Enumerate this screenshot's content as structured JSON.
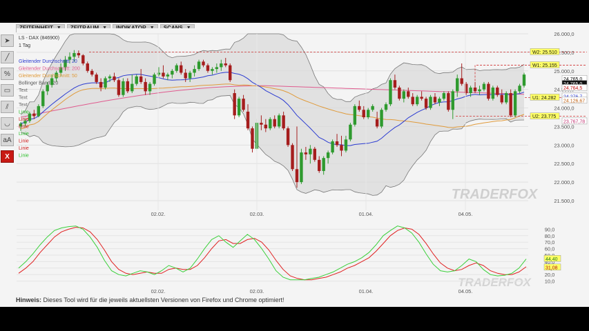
{
  "menu": [
    {
      "label": "ZEITEINHEIT"
    },
    {
      "label": "ZEITRAUM"
    },
    {
      "label": "INDIKATOR"
    },
    {
      "label": "SCANS"
    }
  ],
  "tools": [
    {
      "name": "cursor-tool-icon",
      "glyph": "➤",
      "red": false
    },
    {
      "name": "line-tool-icon",
      "glyph": "╱",
      "red": false
    },
    {
      "name": "percent-tool-icon",
      "glyph": "%",
      "red": false
    },
    {
      "name": "ruler-tool-icon",
      "glyph": "▭",
      "red": false
    },
    {
      "name": "parallel-lines-tool-icon",
      "glyph": "⫽",
      "red": false
    },
    {
      "name": "curve-tool-icon",
      "glyph": "◡",
      "red": false
    },
    {
      "name": "text-tool-icon",
      "glyph": "aA",
      "red": false
    },
    {
      "name": "delete-tool-icon",
      "glyph": "X",
      "red": true
    }
  ],
  "legend": {
    "symbol": "LS - DAX (846900)",
    "timeframe": "1 Tag",
    "entries": [
      {
        "text": "Gleitender Durchschnitt: 20",
        "color": "#2b3bd1"
      },
      {
        "text": "Gleitender Durchschnitt: 200",
        "color": "#e05a8e"
      },
      {
        "text": "Gleitender Durchschnitt: 50",
        "color": "#e09a3a"
      },
      {
        "text": "Bollinger Band: 20",
        "color": "#555555"
      },
      {
        "text": "Text",
        "color": "#666666"
      },
      {
        "text": "Text",
        "color": "#666666"
      },
      {
        "text": "Text",
        "color": "#666666"
      },
      {
        "text": "Linie",
        "color": "#2bbf2b"
      },
      {
        "text": "Linie",
        "color": "#d02020"
      },
      {
        "text": "Linie",
        "color": "#d02020"
      },
      {
        "text": "Linie",
        "color": "#2bbf2b"
      },
      {
        "text": "Linie",
        "color": "#d02020"
      },
      {
        "text": "Linie",
        "color": "#d02020"
      },
      {
        "text": "Linie",
        "color": "#2bbf2b"
      }
    ]
  },
  "price_axis": {
    "ticks": [
      "26.000,0",
      "25.500,0",
      "25.000,0",
      "24.500,0",
      "24.000,0",
      "23.500,0",
      "23.000,0",
      "22.500,0",
      "22.000,0",
      "21.500,0"
    ],
    "tick_values": [
      26000,
      25500,
      25000,
      24500,
      24000,
      23500,
      23000,
      22500,
      22000,
      21500
    ],
    "min": 21500,
    "max": 26000,
    "current_labels": [
      {
        "text": "24.765,0",
        "value": 24785,
        "bg": "#ffffff",
        "fg": "#000000"
      },
      {
        "text": "24.765,0",
        "value": 24650,
        "bg": "#111111",
        "fg": "#ffffff"
      },
      {
        "text": "24.764,5",
        "value": 24540,
        "bg": "#ffffff",
        "fg": "#c01010"
      },
      {
        "text": "24.276,7",
        "value": 24310,
        "bg": "#ffffff",
        "fg": "#2b3bd1"
      },
      {
        "text": "24.126,67",
        "value": 24200,
        "bg": "#ffffff",
        "fg": "#c06010"
      },
      {
        "text": "23.767,78",
        "value": 23640,
        "bg": "#ffffff",
        "fg": "#c03070"
      }
    ],
    "levels": [
      {
        "label": "W2: 25.510",
        "value": 25510
      },
      {
        "label": "W1: 25.155",
        "value": 25155
      },
      {
        "label": "U1: 24.282",
        "value": 24282
      },
      {
        "label": "U2: 23.775",
        "value": 23775
      }
    ]
  },
  "time_axis": [
    "02.02.",
    "02.03.",
    "01.04.",
    "04.05."
  ],
  "oscillator_axis": {
    "ticks": [
      "90,0",
      "80,0",
      "70,0",
      "60,0",
      "50,0",
      "40,0",
      "30,0",
      "20,0",
      "10,0"
    ],
    "tick_values": [
      90,
      80,
      70,
      60,
      50,
      40,
      30,
      20,
      10
    ],
    "labels": [
      {
        "text": "44,40",
        "value": 44.4
      },
      {
        "text": "31,08",
        "value": 31.08
      }
    ]
  },
  "watermark": "TRADERFOX",
  "footer": {
    "bold": "Hinweis:",
    "text": " Dieses Tool wird für die jeweils aktuellsten Versionen von Firefox und Chrome optimiert!"
  },
  "colors": {
    "up": "#2e9a2e",
    "down": "#a51d1d",
    "sma20": "#2b3bd1",
    "sma50": "#e09a3a",
    "sma200": "#e05a8e",
    "stoch_k": "#3ad03a",
    "stoch_d": "#e02020",
    "level_line": "#d03030"
  },
  "candles": [
    {
      "o": 23500,
      "h": 23620,
      "l": 23380,
      "c": 23580
    },
    {
      "o": 23580,
      "h": 23700,
      "l": 23500,
      "c": 23650
    },
    {
      "o": 23650,
      "h": 23900,
      "l": 23600,
      "c": 23850
    },
    {
      "o": 23850,
      "h": 23950,
      "l": 23700,
      "c": 23780
    },
    {
      "o": 23780,
      "h": 24100,
      "l": 23750,
      "c": 24050
    },
    {
      "o": 24050,
      "h": 24500,
      "l": 24000,
      "c": 24450
    },
    {
      "o": 24450,
      "h": 24700,
      "l": 24350,
      "c": 24620
    },
    {
      "o": 24620,
      "h": 24900,
      "l": 24550,
      "c": 24800
    },
    {
      "o": 24800,
      "h": 25000,
      "l": 24700,
      "c": 24950
    },
    {
      "o": 24950,
      "h": 25200,
      "l": 24850,
      "c": 25100
    },
    {
      "o": 25100,
      "h": 25400,
      "l": 25000,
      "c": 25300
    },
    {
      "o": 25300,
      "h": 25500,
      "l": 25200,
      "c": 25380
    },
    {
      "o": 25380,
      "h": 25560,
      "l": 25250,
      "c": 25480
    },
    {
      "o": 25480,
      "h": 25550,
      "l": 25350,
      "c": 25420
    },
    {
      "o": 25420,
      "h": 25450,
      "l": 25150,
      "c": 25200
    },
    {
      "o": 25200,
      "h": 25250,
      "l": 24950,
      "c": 25000
    },
    {
      "o": 25000,
      "h": 25050,
      "l": 24850,
      "c": 24900
    },
    {
      "o": 24900,
      "h": 24950,
      "l": 24650,
      "c": 24700
    },
    {
      "o": 24700,
      "h": 24800,
      "l": 24450,
      "c": 24550
    },
    {
      "o": 24550,
      "h": 24850,
      "l": 24500,
      "c": 24800
    },
    {
      "o": 24800,
      "h": 24900,
      "l": 24700,
      "c": 24850
    },
    {
      "o": 24850,
      "h": 24950,
      "l": 24700,
      "c": 24750
    },
    {
      "o": 24750,
      "h": 24800,
      "l": 24300,
      "c": 24350
    },
    {
      "o": 24350,
      "h": 24800,
      "l": 24300,
      "c": 24720
    },
    {
      "o": 24720,
      "h": 24800,
      "l": 24400,
      "c": 24450
    },
    {
      "o": 24450,
      "h": 24900,
      "l": 24400,
      "c": 24650
    },
    {
      "o": 24650,
      "h": 24900,
      "l": 24600,
      "c": 24850
    },
    {
      "o": 24850,
      "h": 25050,
      "l": 24650,
      "c": 24700
    },
    {
      "o": 24700,
      "h": 24800,
      "l": 24350,
      "c": 24450
    },
    {
      "o": 24450,
      "h": 24700,
      "l": 24350,
      "c": 24650
    },
    {
      "o": 24650,
      "h": 24950,
      "l": 24600,
      "c": 24900
    },
    {
      "o": 24900,
      "h": 25100,
      "l": 24850,
      "c": 24950
    },
    {
      "o": 24950,
      "h": 25150,
      "l": 24800,
      "c": 24850
    },
    {
      "o": 24850,
      "h": 24950,
      "l": 24750,
      "c": 24900
    },
    {
      "o": 24900,
      "h": 25050,
      "l": 24800,
      "c": 25000
    },
    {
      "o": 25000,
      "h": 25200,
      "l": 24950,
      "c": 25150
    },
    {
      "o": 25150,
      "h": 25250,
      "l": 24900,
      "c": 24950
    },
    {
      "o": 24950,
      "h": 25050,
      "l": 24700,
      "c": 24800
    },
    {
      "o": 24800,
      "h": 25000,
      "l": 24700,
      "c": 24950
    },
    {
      "o": 24950,
      "h": 25150,
      "l": 24850,
      "c": 25050
    },
    {
      "o": 25050,
      "h": 25300,
      "l": 25000,
      "c": 25250
    },
    {
      "o": 25250,
      "h": 25300,
      "l": 25100,
      "c": 25150
    },
    {
      "o": 25150,
      "h": 25200,
      "l": 24950,
      "c": 25000
    },
    {
      "o": 25000,
      "h": 25100,
      "l": 24900,
      "c": 25050
    },
    {
      "o": 25050,
      "h": 25200,
      "l": 24950,
      "c": 25100
    },
    {
      "o": 25100,
      "h": 25300,
      "l": 25000,
      "c": 25200
    },
    {
      "o": 25200,
      "h": 25350,
      "l": 25100,
      "c": 25150
    },
    {
      "o": 25150,
      "h": 25200,
      "l": 24700,
      "c": 24750
    },
    {
      "o": 24400,
      "h": 24500,
      "l": 23700,
      "c": 23800
    },
    {
      "o": 23800,
      "h": 24300,
      "l": 23750,
      "c": 24250
    },
    {
      "o": 24250,
      "h": 24350,
      "l": 23900,
      "c": 23950
    },
    {
      "o": 23900,
      "h": 24100,
      "l": 23400,
      "c": 23450
    },
    {
      "o": 23450,
      "h": 23500,
      "l": 22800,
      "c": 22900
    },
    {
      "o": 22900,
      "h": 23700,
      "l": 22850,
      "c": 23600
    },
    {
      "o": 23600,
      "h": 23800,
      "l": 23400,
      "c": 23550
    },
    {
      "o": 23550,
      "h": 23700,
      "l": 23350,
      "c": 23450
    },
    {
      "o": 23450,
      "h": 23750,
      "l": 23400,
      "c": 23700
    },
    {
      "o": 23700,
      "h": 23800,
      "l": 23450,
      "c": 23500
    },
    {
      "o": 23500,
      "h": 23850,
      "l": 23450,
      "c": 23800
    },
    {
      "o": 23800,
      "h": 23900,
      "l": 23400,
      "c": 23450
    },
    {
      "o": 23450,
      "h": 23500,
      "l": 22950,
      "c": 23000
    },
    {
      "o": 23000,
      "h": 23050,
      "l": 22300,
      "c": 22350
    },
    {
      "o": 22350,
      "h": 23500,
      "l": 21850,
      "c": 22000
    },
    {
      "o": 22000,
      "h": 22900,
      "l": 21950,
      "c": 22800
    },
    {
      "o": 22800,
      "h": 22950,
      "l": 22600,
      "c": 22750
    },
    {
      "o": 22750,
      "h": 23000,
      "l": 22500,
      "c": 22900
    },
    {
      "o": 22900,
      "h": 22950,
      "l": 22550,
      "c": 22600
    },
    {
      "o": 22600,
      "h": 22700,
      "l": 22250,
      "c": 22300
    },
    {
      "o": 22300,
      "h": 22700,
      "l": 22200,
      "c": 22650
    },
    {
      "o": 22650,
      "h": 22850,
      "l": 22500,
      "c": 22800
    },
    {
      "o": 22800,
      "h": 23150,
      "l": 22750,
      "c": 23100
    },
    {
      "o": 23100,
      "h": 23300,
      "l": 22950,
      "c": 23000
    },
    {
      "o": 23000,
      "h": 23250,
      "l": 22700,
      "c": 22850
    },
    {
      "o": 22850,
      "h": 23250,
      "l": 22800,
      "c": 23150
    },
    {
      "o": 23150,
      "h": 23600,
      "l": 23100,
      "c": 23550
    },
    {
      "o": 23550,
      "h": 24100,
      "l": 23500,
      "c": 24050
    },
    {
      "o": 24050,
      "h": 24200,
      "l": 23900,
      "c": 23950
    },
    {
      "o": 23950,
      "h": 24050,
      "l": 23700,
      "c": 23750
    },
    {
      "o": 23750,
      "h": 24000,
      "l": 23700,
      "c": 23950
    },
    {
      "o": 23950,
      "h": 24100,
      "l": 23900,
      "c": 24050
    },
    {
      "o": 23700,
      "h": 23900,
      "l": 23450,
      "c": 23500
    },
    {
      "o": 23500,
      "h": 24000,
      "l": 23450,
      "c": 23950
    },
    {
      "o": 23950,
      "h": 24150,
      "l": 23900,
      "c": 24100
    },
    {
      "o": 24100,
      "h": 24800,
      "l": 24050,
      "c": 24750
    },
    {
      "o": 24750,
      "h": 24900,
      "l": 24500,
      "c": 24550
    },
    {
      "o": 24550,
      "h": 24600,
      "l": 24200,
      "c": 24250
    },
    {
      "o": 24250,
      "h": 24500,
      "l": 24150,
      "c": 24450
    },
    {
      "o": 24450,
      "h": 24550,
      "l": 24250,
      "c": 24300
    },
    {
      "o": 24300,
      "h": 24400,
      "l": 24050,
      "c": 24100
    },
    {
      "o": 24100,
      "h": 24350,
      "l": 24050,
      "c": 24300
    },
    {
      "o": 24300,
      "h": 24450,
      "l": 24200,
      "c": 24250
    },
    {
      "o": 24250,
      "h": 24300,
      "l": 23950,
      "c": 24000
    },
    {
      "o": 24000,
      "h": 24350,
      "l": 23950,
      "c": 24300
    },
    {
      "o": 24300,
      "h": 24400,
      "l": 24100,
      "c": 24150
    },
    {
      "o": 24150,
      "h": 24300,
      "l": 24050,
      "c": 24250
    },
    {
      "o": 24250,
      "h": 24450,
      "l": 24200,
      "c": 24400
    },
    {
      "o": 24400,
      "h": 24450,
      "l": 23900,
      "c": 23950
    },
    {
      "o": 23950,
      "h": 24500,
      "l": 23700,
      "c": 24450
    },
    {
      "o": 24450,
      "h": 24900,
      "l": 24300,
      "c": 24800
    },
    {
      "o": 24800,
      "h": 25200,
      "l": 24600,
      "c": 24650
    },
    {
      "o": 24650,
      "h": 24700,
      "l": 24350,
      "c": 24400
    },
    {
      "o": 24400,
      "h": 24600,
      "l": 24300,
      "c": 24550
    },
    {
      "o": 24550,
      "h": 24700,
      "l": 24400,
      "c": 24450
    },
    {
      "o": 24450,
      "h": 24600,
      "l": 24350,
      "c": 24500
    },
    {
      "o": 24500,
      "h": 24700,
      "l": 24450,
      "c": 24650
    },
    {
      "o": 24650,
      "h": 24700,
      "l": 24200,
      "c": 24250
    },
    {
      "o": 24250,
      "h": 24600,
      "l": 24200,
      "c": 24550
    },
    {
      "o": 24550,
      "h": 24600,
      "l": 24300,
      "c": 24350
    },
    {
      "o": 24350,
      "h": 24500,
      "l": 24100,
      "c": 24150
    },
    {
      "o": 24150,
      "h": 24450,
      "l": 24100,
      "c": 24400
    },
    {
      "o": 24400,
      "h": 24500,
      "l": 23750,
      "c": 23800
    },
    {
      "o": 23800,
      "h": 24500,
      "l": 23750,
      "c": 24450
    },
    {
      "o": 24450,
      "h": 24650,
      "l": 24400,
      "c": 24600
    },
    {
      "o": 24600,
      "h": 24950,
      "l": 24550,
      "c": 24900
    }
  ],
  "stoch": {
    "k": [
      30,
      40,
      52,
      66,
      78,
      88,
      92,
      94,
      95,
      90,
      78,
      62,
      42,
      26,
      20,
      18,
      22,
      26,
      24,
      20,
      26,
      34,
      30,
      24,
      30,
      44,
      60,
      74,
      80,
      70,
      62,
      72,
      82,
      74,
      60,
      44,
      26,
      16,
      12,
      12,
      12,
      14,
      16,
      20,
      24,
      30,
      36,
      40,
      46,
      54,
      66,
      80,
      88,
      95,
      92,
      84,
      70,
      52,
      36,
      26,
      24,
      26,
      34,
      44,
      40,
      28,
      20,
      18,
      19,
      22,
      30,
      44
    ],
    "d": [
      22,
      30,
      40,
      54,
      66,
      78,
      86,
      90,
      93,
      92,
      86,
      74,
      58,
      40,
      28,
      22,
      20,
      22,
      24,
      22,
      22,
      28,
      30,
      28,
      28,
      34,
      46,
      60,
      72,
      74,
      68,
      68,
      74,
      76,
      70,
      58,
      42,
      28,
      18,
      14,
      12,
      12,
      14,
      16,
      20,
      24,
      30,
      34,
      40,
      46,
      56,
      68,
      80,
      88,
      92,
      90,
      82,
      68,
      52,
      38,
      30,
      26,
      28,
      34,
      38,
      34,
      26,
      22,
      20,
      20,
      24,
      32
    ]
  }
}
